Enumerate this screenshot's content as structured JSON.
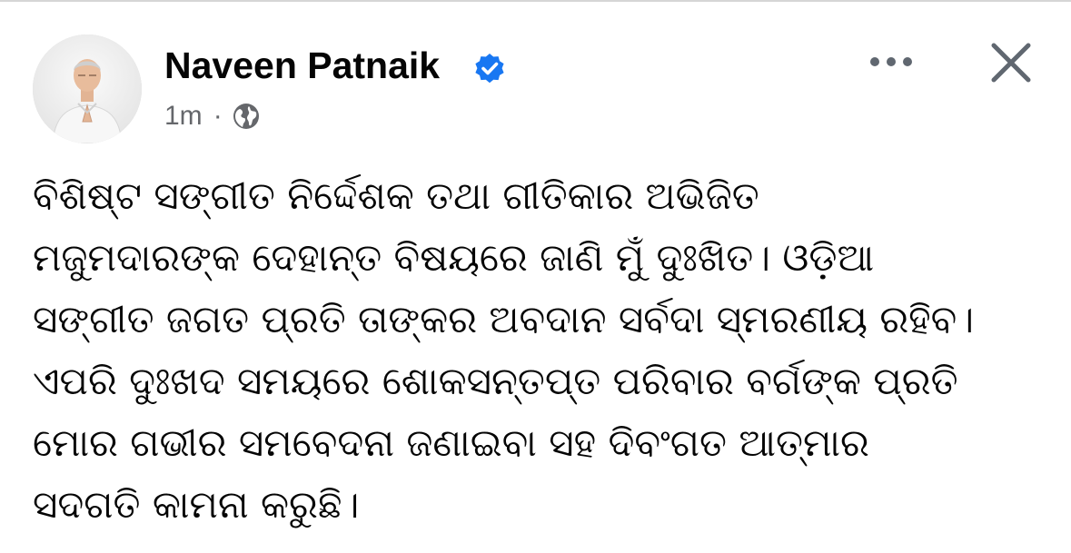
{
  "post": {
    "author": "Naveen Patnaik",
    "verified": true,
    "timestamp": "1m",
    "separator": "·",
    "audience_icon": "globe-icon",
    "lines": [
      "ବିଶିଷ୍ଟ ସଙ୍ଗୀତ ନିର୍ଦ୍ଦେଶକ ତଥା ଗୀତିକାର ଅଭିଜିତ",
      "ମଜୁମଦାରଙ୍କ ଦେହାନ୍ତ ବିଷୟରେ ଜାଣି ମୁଁ ଦୁଃଖିତ। ଓଡ଼ିଆ",
      "ସଙ୍ଗୀତ ଜଗତ ପ୍ରତି ତାଙ୍କର ଅବଦାନ ସର୍ବଦା ସ୍ମରଣୀୟ ରହିବ।",
      "ଏପରି ଦୁଃଖଦ ସମୟରେ ଶୋକସନ୍ତପ୍ତ ପରିବାର ବର୍ଗଙ୍କ ପ୍ରତି",
      "ମୋର ଗଭୀର ସମବେଦନା ଜଣାଇବା ସହ ଦିବଂଗତ ଆତ୍ମାର",
      "ସଦଗତି କାମନା କରୁଛି।"
    ]
  },
  "colors": {
    "verified_blue": "#1877f2",
    "meta_gray": "#65676b",
    "text": "#050505",
    "icon_dark": "#606770"
  },
  "icons": {
    "more": "more-options-icon",
    "close": "close-icon",
    "verified": "verified-badge-icon"
  }
}
